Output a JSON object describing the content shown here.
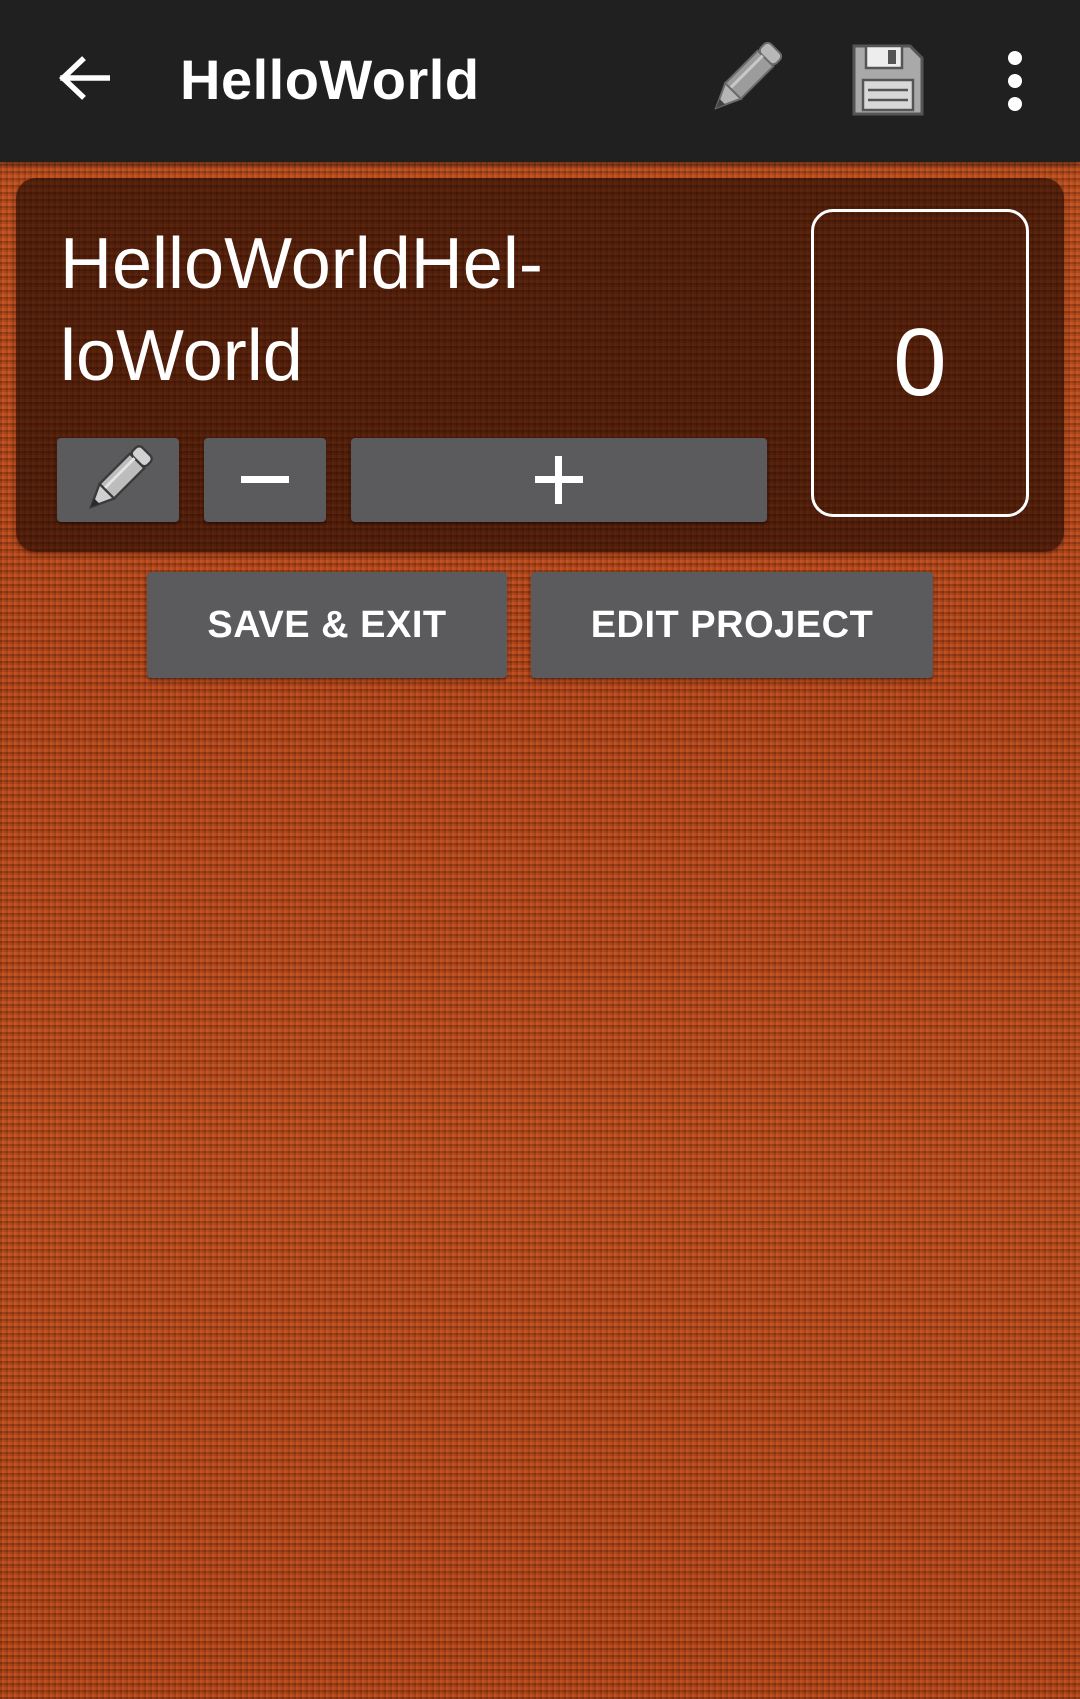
{
  "appbar": {
    "title": "HelloWorld",
    "icons": [
      "back-arrow-icon",
      "pencil-icon",
      "floppy-disk-icon",
      "more-vert-icon"
    ]
  },
  "counter": {
    "name": "HelloWorldHel-\nloWorld",
    "value": "0",
    "buttons": {
      "edit_icon": "pencil-icon",
      "decrement_icon": "minus-icon",
      "increment_icon": "plus-icon"
    }
  },
  "actions": {
    "save_exit_label": "SAVE & EXIT",
    "edit_project_label": "EDIT PROJECT"
  },
  "colors": {
    "appbar": "#202020",
    "button": "#5b5b5d",
    "background": "#b84a1c",
    "text": "#ffffff"
  }
}
